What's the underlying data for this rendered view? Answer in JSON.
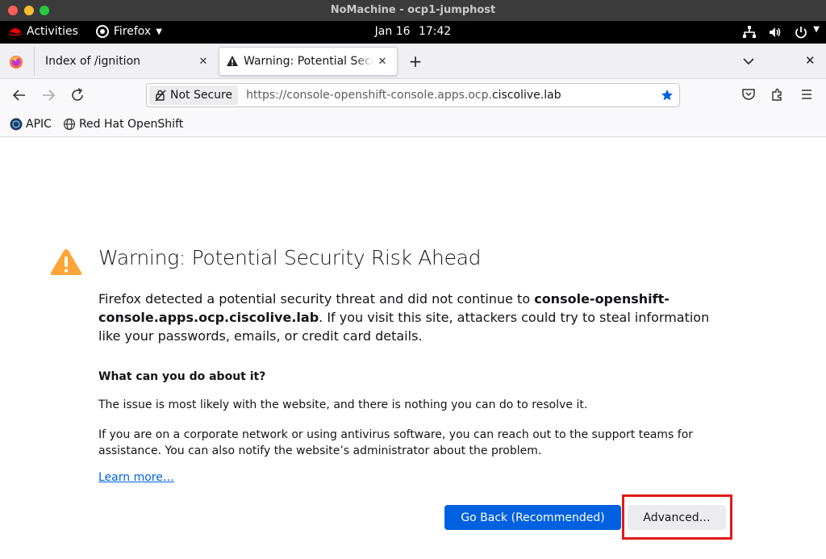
{
  "window": {
    "title": "NoMachine - ocp1-jumphost"
  },
  "gnome": {
    "activities": "Activities",
    "app_menu": "Firefox",
    "date": "Jan 16",
    "time": "17:42"
  },
  "tabs": [
    {
      "label": "Index of /ignition",
      "active": false
    },
    {
      "label": "Warning: Potential Security Risk Ahead",
      "active": true
    }
  ],
  "urlbar": {
    "security_label": "Not Secure",
    "url_prefix": "https://console-openshift-console.apps.ocp.",
    "url_domain": "ciscolive.lab"
  },
  "bookmarks": [
    {
      "label": "APIC",
      "icon": "apic-icon"
    },
    {
      "label": "Red Hat OpenShift",
      "icon": "globe-icon"
    }
  ],
  "error_page": {
    "title": "Warning: Potential Security Risk Ahead",
    "intro_before": "Firefox detected a potential security threat and did not continue to ",
    "intro_host": "console-openshift-console.apps.ocp.ciscolive.lab",
    "intro_after": ". If you visit this site, attackers could try to steal information like your passwords, emails, or credit card details.",
    "what_heading": "What can you do about it?",
    "para1": "The issue is most likely with the website, and there is nothing you can do to resolve it.",
    "para2": "If you are on a corporate network or using antivirus software, you can reach out to the support teams for assistance. You can also notify the website’s administrator about the problem.",
    "learn_more": "Learn more…",
    "go_back_label": "Go Back (Recommended)",
    "advanced_label": "Advanced…"
  },
  "colors": {
    "primary_button": "#0061e0",
    "warning_icon": "#ffa436",
    "highlight_box": "#e01b1b",
    "bookmark_star": "#0061e0"
  }
}
